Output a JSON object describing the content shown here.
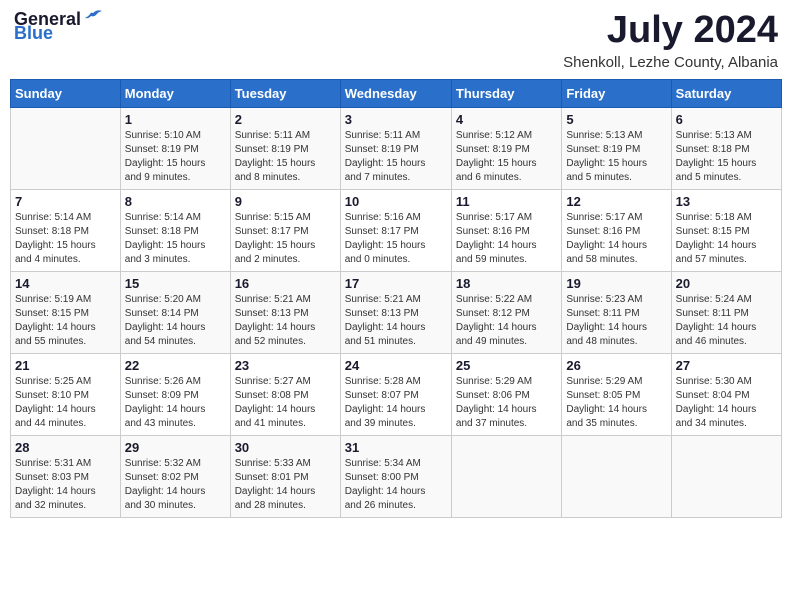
{
  "header": {
    "logo_general": "General",
    "logo_blue": "Blue",
    "month_year": "July 2024",
    "location": "Shenkoll, Lezhe County, Albania"
  },
  "calendar": {
    "weekdays": [
      "Sunday",
      "Monday",
      "Tuesday",
      "Wednesday",
      "Thursday",
      "Friday",
      "Saturday"
    ],
    "weeks": [
      [
        {
          "day": "",
          "detail": ""
        },
        {
          "day": "1",
          "detail": "Sunrise: 5:10 AM\nSunset: 8:19 PM\nDaylight: 15 hours\nand 9 minutes."
        },
        {
          "day": "2",
          "detail": "Sunrise: 5:11 AM\nSunset: 8:19 PM\nDaylight: 15 hours\nand 8 minutes."
        },
        {
          "day": "3",
          "detail": "Sunrise: 5:11 AM\nSunset: 8:19 PM\nDaylight: 15 hours\nand 7 minutes."
        },
        {
          "day": "4",
          "detail": "Sunrise: 5:12 AM\nSunset: 8:19 PM\nDaylight: 15 hours\nand 6 minutes."
        },
        {
          "day": "5",
          "detail": "Sunrise: 5:13 AM\nSunset: 8:19 PM\nDaylight: 15 hours\nand 5 minutes."
        },
        {
          "day": "6",
          "detail": "Sunrise: 5:13 AM\nSunset: 8:18 PM\nDaylight: 15 hours\nand 5 minutes."
        }
      ],
      [
        {
          "day": "7",
          "detail": "Sunrise: 5:14 AM\nSunset: 8:18 PM\nDaylight: 15 hours\nand 4 minutes."
        },
        {
          "day": "8",
          "detail": "Sunrise: 5:14 AM\nSunset: 8:18 PM\nDaylight: 15 hours\nand 3 minutes."
        },
        {
          "day": "9",
          "detail": "Sunrise: 5:15 AM\nSunset: 8:17 PM\nDaylight: 15 hours\nand 2 minutes."
        },
        {
          "day": "10",
          "detail": "Sunrise: 5:16 AM\nSunset: 8:17 PM\nDaylight: 15 hours\nand 0 minutes."
        },
        {
          "day": "11",
          "detail": "Sunrise: 5:17 AM\nSunset: 8:16 PM\nDaylight: 14 hours\nand 59 minutes."
        },
        {
          "day": "12",
          "detail": "Sunrise: 5:17 AM\nSunset: 8:16 PM\nDaylight: 14 hours\nand 58 minutes."
        },
        {
          "day": "13",
          "detail": "Sunrise: 5:18 AM\nSunset: 8:15 PM\nDaylight: 14 hours\nand 57 minutes."
        }
      ],
      [
        {
          "day": "14",
          "detail": "Sunrise: 5:19 AM\nSunset: 8:15 PM\nDaylight: 14 hours\nand 55 minutes."
        },
        {
          "day": "15",
          "detail": "Sunrise: 5:20 AM\nSunset: 8:14 PM\nDaylight: 14 hours\nand 54 minutes."
        },
        {
          "day": "16",
          "detail": "Sunrise: 5:21 AM\nSunset: 8:13 PM\nDaylight: 14 hours\nand 52 minutes."
        },
        {
          "day": "17",
          "detail": "Sunrise: 5:21 AM\nSunset: 8:13 PM\nDaylight: 14 hours\nand 51 minutes."
        },
        {
          "day": "18",
          "detail": "Sunrise: 5:22 AM\nSunset: 8:12 PM\nDaylight: 14 hours\nand 49 minutes."
        },
        {
          "day": "19",
          "detail": "Sunrise: 5:23 AM\nSunset: 8:11 PM\nDaylight: 14 hours\nand 48 minutes."
        },
        {
          "day": "20",
          "detail": "Sunrise: 5:24 AM\nSunset: 8:11 PM\nDaylight: 14 hours\nand 46 minutes."
        }
      ],
      [
        {
          "day": "21",
          "detail": "Sunrise: 5:25 AM\nSunset: 8:10 PM\nDaylight: 14 hours\nand 44 minutes."
        },
        {
          "day": "22",
          "detail": "Sunrise: 5:26 AM\nSunset: 8:09 PM\nDaylight: 14 hours\nand 43 minutes."
        },
        {
          "day": "23",
          "detail": "Sunrise: 5:27 AM\nSunset: 8:08 PM\nDaylight: 14 hours\nand 41 minutes."
        },
        {
          "day": "24",
          "detail": "Sunrise: 5:28 AM\nSunset: 8:07 PM\nDaylight: 14 hours\nand 39 minutes."
        },
        {
          "day": "25",
          "detail": "Sunrise: 5:29 AM\nSunset: 8:06 PM\nDaylight: 14 hours\nand 37 minutes."
        },
        {
          "day": "26",
          "detail": "Sunrise: 5:29 AM\nSunset: 8:05 PM\nDaylight: 14 hours\nand 35 minutes."
        },
        {
          "day": "27",
          "detail": "Sunrise: 5:30 AM\nSunset: 8:04 PM\nDaylight: 14 hours\nand 34 minutes."
        }
      ],
      [
        {
          "day": "28",
          "detail": "Sunrise: 5:31 AM\nSunset: 8:03 PM\nDaylight: 14 hours\nand 32 minutes."
        },
        {
          "day": "29",
          "detail": "Sunrise: 5:32 AM\nSunset: 8:02 PM\nDaylight: 14 hours\nand 30 minutes."
        },
        {
          "day": "30",
          "detail": "Sunrise: 5:33 AM\nSunset: 8:01 PM\nDaylight: 14 hours\nand 28 minutes."
        },
        {
          "day": "31",
          "detail": "Sunrise: 5:34 AM\nSunset: 8:00 PM\nDaylight: 14 hours\nand 26 minutes."
        },
        {
          "day": "",
          "detail": ""
        },
        {
          "day": "",
          "detail": ""
        },
        {
          "day": "",
          "detail": ""
        }
      ]
    ]
  }
}
